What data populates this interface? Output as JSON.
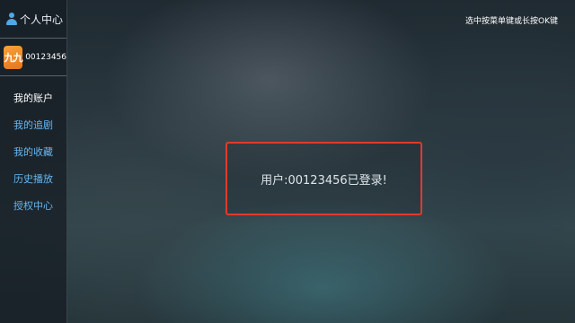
{
  "sidebar": {
    "title": "个人中心",
    "user": {
      "avatar_text": "九九",
      "username": "00123456"
    },
    "items": [
      {
        "label": "我的账户",
        "active": true
      },
      {
        "label": "我的追剧",
        "active": false
      },
      {
        "label": "我的收藏",
        "active": false
      },
      {
        "label": "历史播放",
        "active": false
      },
      {
        "label": "授权中心",
        "active": false
      }
    ]
  },
  "hint": "选中按菜单键或长按OK键",
  "dialog": {
    "message": "用户:00123456已登录!"
  },
  "colors": {
    "accent": "#67b6f2",
    "highlight_border": "#e23a2c",
    "avatar": "#f29330"
  },
  "icons": {
    "header": "user-icon"
  }
}
